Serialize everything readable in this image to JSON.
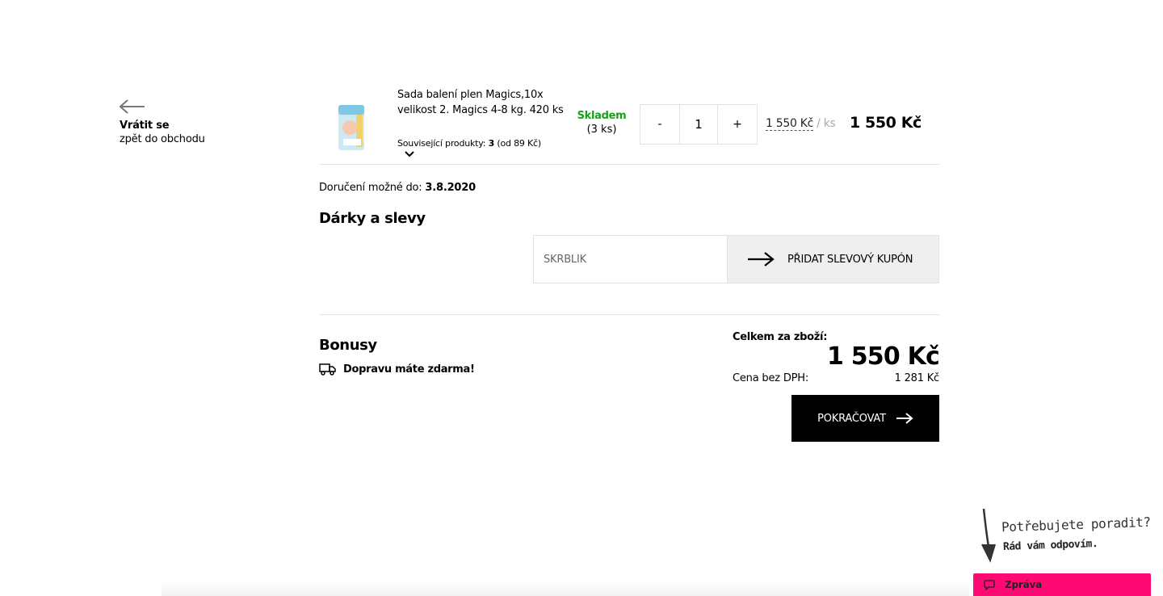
{
  "back": {
    "line1": "Vrátit se",
    "line2": "zpět do obchodu",
    "icon": "arrow-left-icon"
  },
  "product": {
    "name": "Sada balení plen Magics,10x velikost 2. Magics 4-8 kg. 420 ks",
    "related_label": "Související produkty:",
    "related_count": "3",
    "related_from": "(od 89 Kč)",
    "stock_status": "Skladem",
    "stock_qty": "(3 ks)",
    "stock_color": "#17a11a",
    "qty_minus": "-",
    "qty_value": "1",
    "qty_plus": "+",
    "unit_price": "1 550 Kč",
    "unit_suffix": "/ ks",
    "line_total": "1 550 Kč"
  },
  "delivery": {
    "label": "Doručení možné do:",
    "date": "3.8.2020"
  },
  "gifts": {
    "title": "Dárky a slevy",
    "coupon_placeholder": "SKRBLÍK",
    "coupon_button": "PŘIDAT SLEVOVÝ KUPÓN"
  },
  "bonus": {
    "title": "Bonusy",
    "shipping_text": "Dopravu máte zdarma!",
    "icon": "truck-icon"
  },
  "totals": {
    "sum_label": "Celkem za zboží:",
    "sum_value": "1 550 Kč",
    "no_vat_label": "Cena bez DPH:",
    "no_vat_value": "1 281 Kč",
    "continue_label": "POKRAČOVAT"
  },
  "chat": {
    "hint_line1": "Potřebujete poradit?",
    "hint_line2": "Rád vám odpovím.",
    "bar_label": "Zpráva",
    "bar_color": "#ff0a75"
  }
}
